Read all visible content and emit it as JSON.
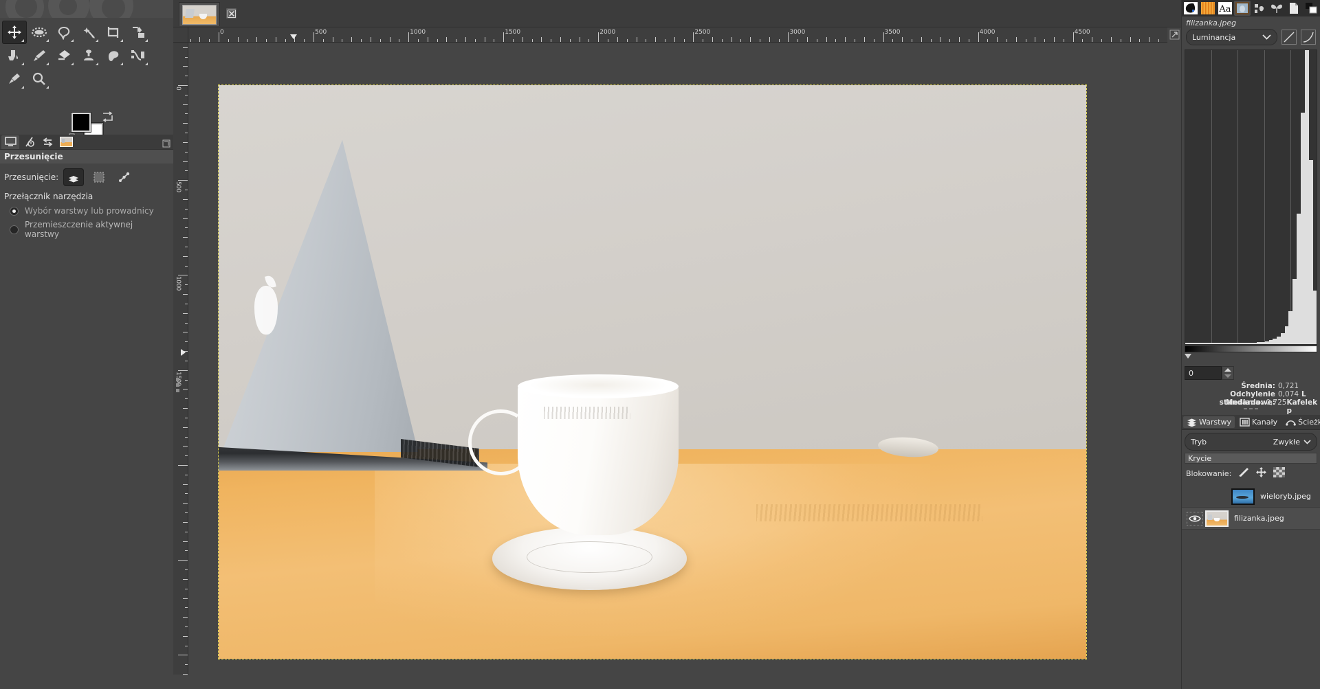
{
  "app": {
    "name": "GIMP",
    "language": "pl"
  },
  "toolbox": {
    "tools": [
      {
        "name": "move-tool",
        "label": "Przesunięcie",
        "active": true
      },
      {
        "name": "ellipse-select-tool",
        "label": "Zaznaczenie eliptyczne",
        "active": false
      },
      {
        "name": "free-select-tool",
        "label": "Zaznaczenie odręczne",
        "active": false
      },
      {
        "name": "fuzzy-select-tool",
        "label": "Różdżka",
        "active": false
      },
      {
        "name": "crop-tool",
        "label": "Kadrowanie",
        "active": false
      },
      {
        "name": "transform-tool",
        "label": "Przekształcenie",
        "active": false
      },
      {
        "name": "bucket-fill-tool",
        "label": "Wypełnienie kubełkiem",
        "active": false
      },
      {
        "name": "paintbrush-tool",
        "label": "Pędzel",
        "active": false
      },
      {
        "name": "eraser-tool",
        "label": "Gumka",
        "active": false
      },
      {
        "name": "clone-tool",
        "label": "Klonowanie",
        "active": false
      },
      {
        "name": "smudge-tool",
        "label": "Rozsmarowywanie",
        "active": false
      },
      {
        "name": "paths-tool",
        "label": "Ścieżki",
        "active": false
      },
      {
        "name": "color-picker-tool",
        "label": "Pobranie koloru",
        "active": false
      },
      {
        "name": "zoom-tool",
        "label": "Powiększenie",
        "active": false
      }
    ],
    "foreground_color": "#000000",
    "background_color": "#ffffff"
  },
  "tool_options": {
    "tabs": [
      "tool-options-tab",
      "undo-history-tab",
      "device-status-tab",
      "images-tab"
    ],
    "active_tab_index": 0,
    "title": "Przesunięcie",
    "move_label": "Przesunięcie:",
    "move_modes": [
      {
        "name": "move-layer-mode",
        "active": true
      },
      {
        "name": "move-selection-mode",
        "active": false
      },
      {
        "name": "move-path-mode",
        "active": false
      }
    ],
    "tool_toggle_title": "Przełącznik narzędzia",
    "radios": [
      {
        "label": "Wybór warstwy lub prowadnicy",
        "selected": true
      },
      {
        "label": "Przemieszczenie aktywnej warstwy",
        "selected": false
      }
    ]
  },
  "image_window": {
    "tab_title": "filizanka.jpeg",
    "close_label": "×",
    "ruler_h_labels": [
      "0",
      "500",
      "1000",
      "1500",
      "2000",
      "2500",
      "3000",
      "3500",
      "4000",
      "4500"
    ],
    "ruler_v_labels": [
      "0",
      "500",
      "1000",
      "1500"
    ],
    "unit": "px"
  },
  "histogram": {
    "filename": "filizanka.jpeg",
    "channel": "Luminancja",
    "chevron": "⌄",
    "range_low": "0",
    "stats": [
      {
        "label": "Średnia:",
        "value": "0,721",
        "extra": ""
      },
      {
        "label": "Odchylenie standardowe:",
        "value": "0,074",
        "extra": "L"
      },
      {
        "label": "Mediana:",
        "value": "0,725",
        "extra": "Kafelek p"
      }
    ]
  },
  "chart_data": {
    "type": "bar",
    "title": "Luminancja",
    "xlabel": "",
    "ylabel": "",
    "xlim": [
      0,
      255
    ],
    "grid": true,
    "legend": false,
    "categories": [
      "0",
      "8",
      "16",
      "24",
      "32",
      "40",
      "48",
      "56",
      "64",
      "72",
      "80",
      "88",
      "96",
      "104",
      "112",
      "120",
      "128",
      "136",
      "144",
      "152",
      "160",
      "168",
      "176",
      "184",
      "192",
      "200",
      "208",
      "216",
      "224",
      "232",
      "240",
      "248",
      "255"
    ],
    "values": [
      0.5,
      0.3,
      0.2,
      0.2,
      0.2,
      0.2,
      0.2,
      0.2,
      0.2,
      0.2,
      0.2,
      0.2,
      0.2,
      0.2,
      0.3,
      0.3,
      0.4,
      0.5,
      0.6,
      0.8,
      1.0,
      1.4,
      1.9,
      2.6,
      3.8,
      6.0,
      11.0,
      22.0,
      44.0,
      78.0,
      99.0,
      62.0,
      18.0
    ]
  },
  "layers": {
    "tabs": [
      {
        "name": "layers-tab",
        "label": "Warstwy",
        "active": true
      },
      {
        "name": "channels-tab",
        "label": "Kanały",
        "active": false
      },
      {
        "name": "paths-tab",
        "label": "Ścieżki",
        "active": false
      }
    ],
    "mode_label": "Tryb",
    "mode_value": "Zwykłe",
    "opacity_label": "Krycie",
    "lock_label": "Blokowanie:",
    "lock_buttons": [
      "lock-pixels-icon",
      "lock-position-icon",
      "lock-alpha-icon"
    ],
    "items": [
      {
        "name": "wieloryb.jpeg",
        "visible": false,
        "selected": false,
        "thumb": "whale"
      },
      {
        "name": "filizanka.jpeg",
        "visible": true,
        "selected": true,
        "thumb": "cup"
      }
    ]
  },
  "dock": {
    "tabs": [
      {
        "name": "brushes-tab",
        "active": false
      },
      {
        "name": "gradients-tab",
        "active": false
      },
      {
        "name": "fonts-tab",
        "active": false
      },
      {
        "name": "document-history-tab",
        "active": true
      },
      {
        "name": "patterns-tab",
        "active": false
      },
      {
        "name": "templates-tab",
        "active": false
      },
      {
        "name": "buffers-tab",
        "active": false
      },
      {
        "name": "palettes-tab",
        "active": false
      }
    ]
  },
  "colors": {
    "panel_bg": "#454545",
    "dark_bg": "#2e2e2e",
    "selection": "#d9cf4e",
    "text": "#e8e8e8"
  }
}
